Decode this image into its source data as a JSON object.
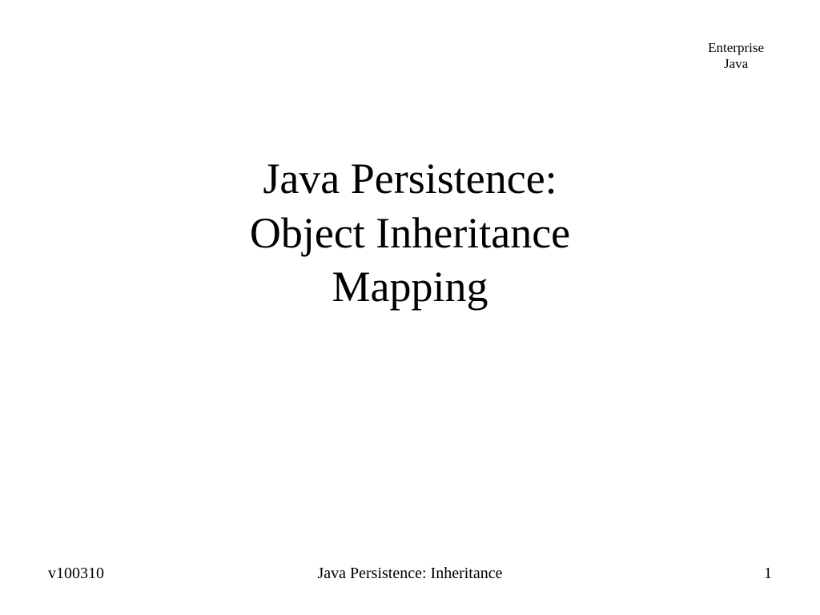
{
  "header": {
    "line1": "Enterprise",
    "line2": "Java"
  },
  "title": {
    "line1": "Java Persistence:",
    "line2": "Object Inheritance",
    "line3": "Mapping"
  },
  "footer": {
    "version": "v100310",
    "center": "Java Persistence: Inheritance",
    "page": "1"
  }
}
